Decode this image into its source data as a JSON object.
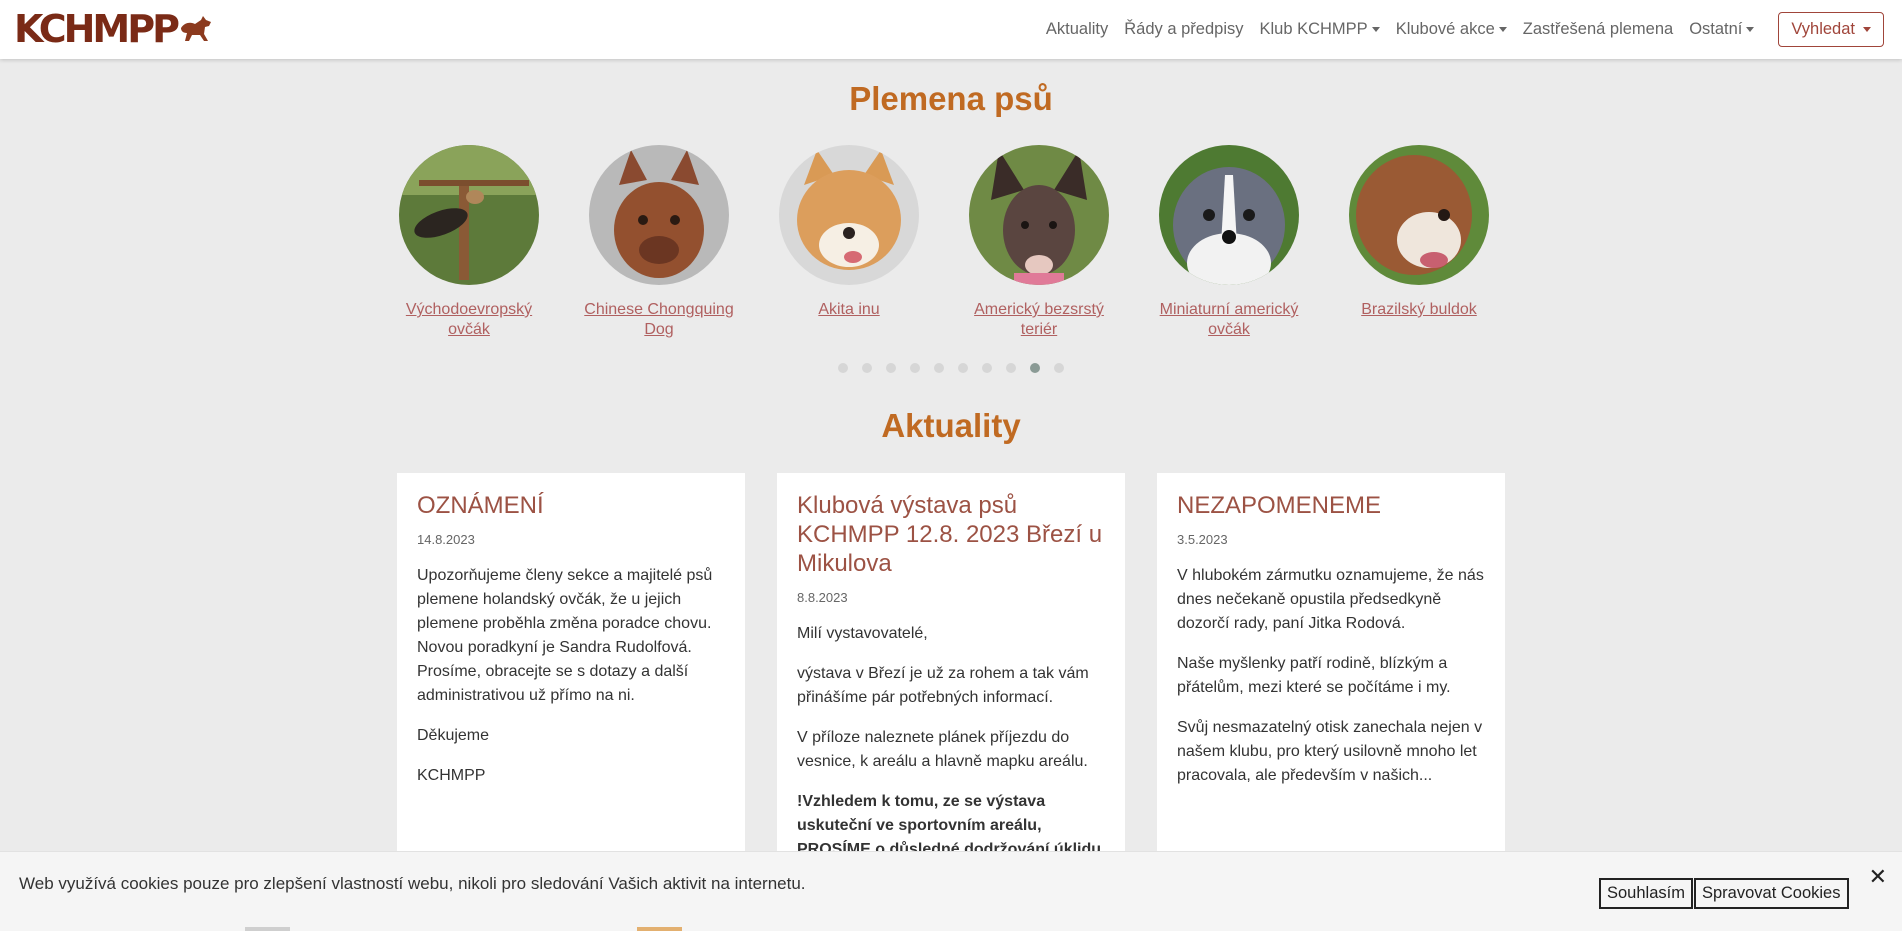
{
  "header": {
    "logo_text": "KCHMPP",
    "nav": [
      {
        "label": "Aktuality",
        "dropdown": false
      },
      {
        "label": "Řády a předpisy",
        "dropdown": false
      },
      {
        "label": "Klub KCHMPP",
        "dropdown": true
      },
      {
        "label": "Klubové akce",
        "dropdown": true
      },
      {
        "label": "Zastřešená plemena",
        "dropdown": false
      },
      {
        "label": "Ostatní",
        "dropdown": true
      }
    ],
    "search_label": "Vyhledat"
  },
  "breeds": {
    "title": "Plemena psů",
    "items": [
      {
        "name": "Východoevropský ovčák",
        "image": "east-european-shepherd-photo"
      },
      {
        "name": "Chinese Chongquing Dog",
        "image": "chongqing-dog-photo"
      },
      {
        "name": "Akita inu",
        "image": "akita-photo"
      },
      {
        "name": "Americký bezsrstý teriér",
        "image": "hairless-terrier-photo"
      },
      {
        "name": "Miniaturní americký ovčák",
        "image": "mini-american-shepherd-photo"
      },
      {
        "name": "Brazilský buldok",
        "image": "brazilian-bulldog-photo"
      }
    ],
    "carousel_pages": 10,
    "carousel_active": 8
  },
  "news": {
    "title": "Aktuality",
    "cards": [
      {
        "title": "OZNÁMENÍ",
        "date": "14.8.2023",
        "paragraphs": [
          {
            "text": "Upozorňujeme členy sekce a majitelé psů plemene holandský ovčák, že u jejich plemene proběhla změna poradce chovu. Novou poradkyní je Sandra Rudolfová. Prosíme, obracejte se s dotazy a další administrativou už přímo na ni.",
            "bold": false
          },
          {
            "text": "Děkujeme",
            "bold": false
          },
          {
            "text": "KCHMPP",
            "bold": false
          }
        ]
      },
      {
        "title": "Klubová výstava psů KCHMPP 12.8. 2023 Březí u Mikulova",
        "date": "8.8.2023",
        "paragraphs": [
          {
            "text": "Milí vystavovatelé,",
            "bold": false
          },
          {
            "text": "výstava v Březí je už za rohem a tak vám přinášíme pár potřebných informací.",
            "bold": false
          },
          {
            "text": "V příloze naleznete plánek příjezdu do vesnice, k areálu a hlavně mapku areálu.",
            "bold": false
          },
          {
            "text": "!Vzhledem k tomu, ze se výstava uskuteční ve sportovním areálu, PROSÍME o důsledné dodržování úklidu psích výkalů!",
            "bold": true
          }
        ]
      },
      {
        "title": "NEZAPOMENEME",
        "date": "3.5.2023",
        "paragraphs": [
          {
            "text": "V hlubokém zármutku oznamujeme, že nás dnes nečekaně opustila předsedkyně dozorčí rady, paní Jitka Rodová.",
            "bold": false
          },
          {
            "text": "Naše myšlenky patří rodině, blízkým a přátelům, mezi které se počítáme i my.",
            "bold": false
          },
          {
            "text": "Svůj nesmazatelný otisk zanechala nejen v našem klubu, pro který usilovně mnoho let pracovala, ale především v našich...",
            "bold": false
          }
        ]
      }
    ]
  },
  "cookie_bar": {
    "text": "Web využívá cookies pouze pro zlepšení vlastností webu, nikoli pro sledování Vašich aktivit na internetu.",
    "accept_label": "Souhlasím",
    "manage_label": "Spravovat Cookies",
    "close_symbol": "✕"
  },
  "colors": {
    "accent_heading": "#c06a22",
    "link": "#b06060",
    "card_title": "#9c5244",
    "logo": "#7a2a16"
  }
}
